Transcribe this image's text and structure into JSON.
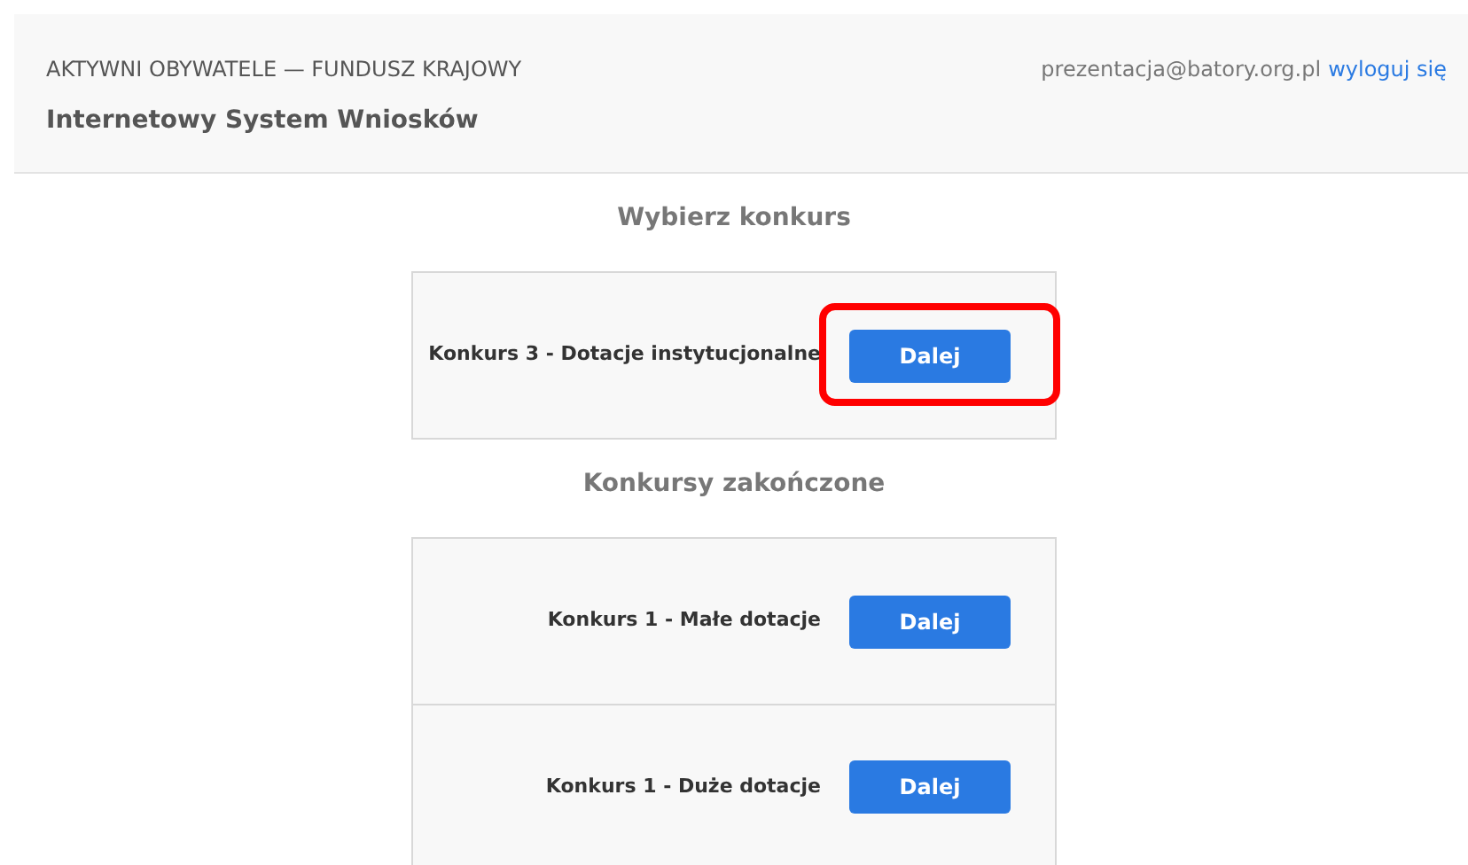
{
  "header": {
    "organization": "AKTYWNI OBYWATELE — FUNDUSZ KRAJOWY",
    "system_title": "Internetowy System Wniosków",
    "user_email": "prezentacja@batory.org.pl",
    "logout_link": "wyloguj się"
  },
  "sections": [
    {
      "title": "Wybierz konkurs",
      "items": [
        {
          "name": "Konkurs 3 - Dotacje instytucjonalne",
          "button": "Dalej",
          "highlighted": true
        }
      ]
    },
    {
      "title": "Konkursy zakończone",
      "items": [
        {
          "name": "Konkurs 1 - Małe dotacje",
          "button": "Dalej",
          "highlighted": false
        },
        {
          "name": "Konkurs 1 - Duże dotacje",
          "button": "Dalej",
          "highlighted": false
        }
      ]
    }
  ]
}
